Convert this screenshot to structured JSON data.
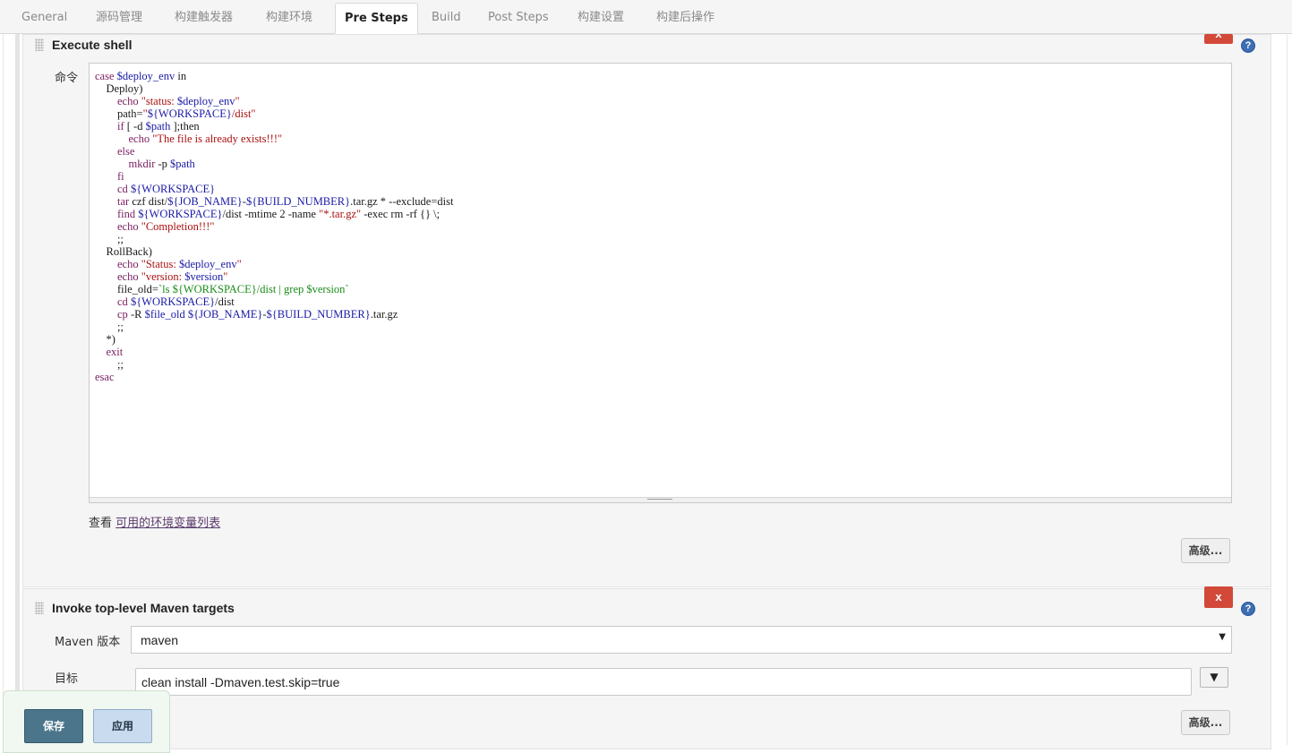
{
  "tabs": [
    {
      "label": "General"
    },
    {
      "label": "源码管理"
    },
    {
      "label": "构建触发器"
    },
    {
      "label": "构建环境"
    },
    {
      "label": "Pre Steps"
    },
    {
      "label": "Build"
    },
    {
      "label": "Post Steps"
    },
    {
      "label": "构建设置"
    },
    {
      "label": "构建后操作"
    }
  ],
  "active_tab": "Pre Steps",
  "execute_shell": {
    "title": "Execute shell",
    "delete_label": "x",
    "help_label": "?",
    "command_label": "命令",
    "command": "case $deploy_env in\n    Deploy)\n        echo \"status: $deploy_env\"\n        path=\"${WORKSPACE}/dist\"\n        if [ -d $path ];then\n            echo \"The file is already exists!!!\"\n        else\n            mkdir -p $path\n        fi\n        cd ${WORKSPACE}\n        tar czf dist/${JOB_NAME}-${BUILD_NUMBER}.tar.gz * --exclude=dist\n        find ${WORKSPACE}/dist -mtime 2 -name \"*.tar.gz\" -exec rm -rf {} \\;\n        echo \"Completion!!!\"\n        ;;\n    RollBack)\n        echo \"Status: $deploy_env\"\n        echo \"version: $version\"\n        file_old=`ls ${WORKSPACE}/dist | grep $version`\n        cd ${WORKSPACE}/dist\n        cp -R $file_old ${JOB_NAME}-${BUILD_NUMBER}.tar.gz\n        ;;\n    *)\n    exit\n        ;;\nesac",
    "env_prefix": "查看 ",
    "env_link": "可用的环境变量列表",
    "advanced_label": "高级..."
  },
  "maven": {
    "title": "Invoke top-level Maven targets",
    "delete_label": "x",
    "help_label": "?",
    "version_label": "Maven 版本",
    "version_value": "maven",
    "goals_label": "目标",
    "goals_value": "clean install -Dmaven.test.skip=true",
    "expand_icon": "▼",
    "advanced_label": "高级..."
  },
  "footer": {
    "save_label": "保存",
    "apply_label": "应用"
  }
}
